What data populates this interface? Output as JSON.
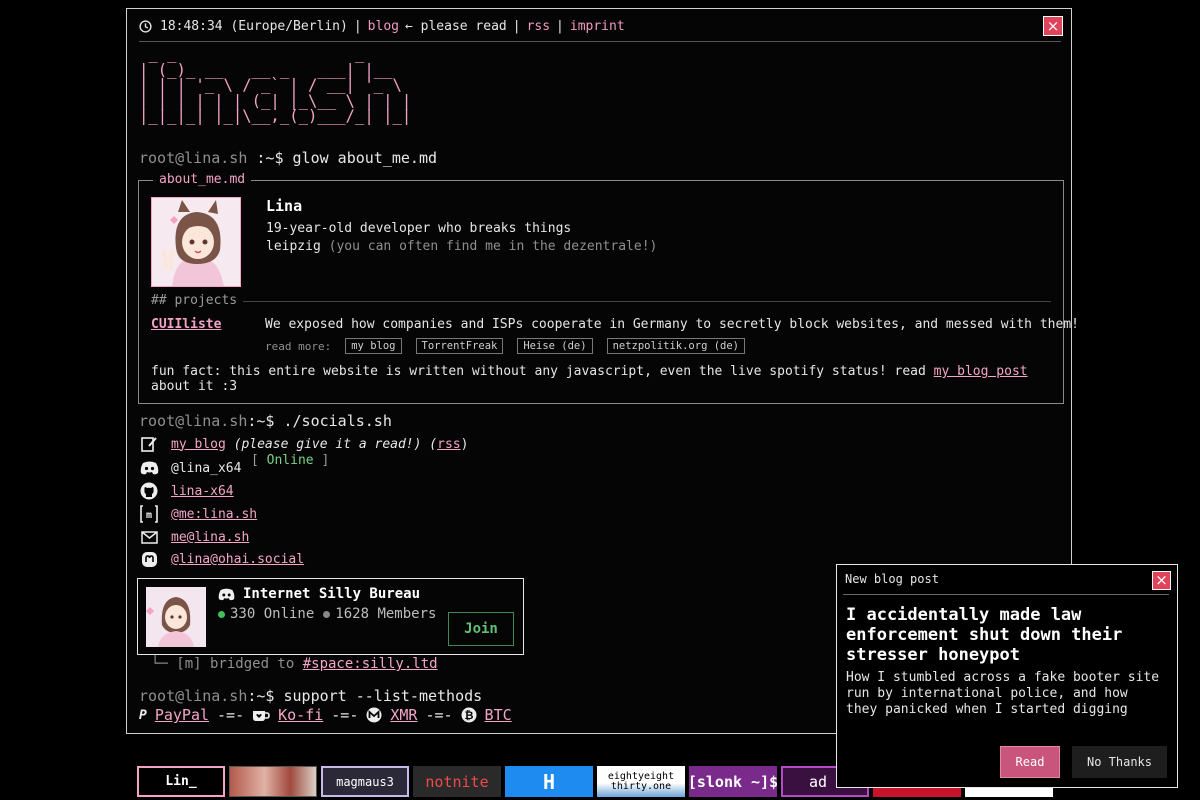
{
  "topbar": {
    "time": "18:48:34 (Europe/Berlin)",
    "blog": "blog",
    "please_read": "← please read",
    "rss": "rss",
    "imprint": "imprint",
    "sep": "|"
  },
  "close_symbol": "×",
  "ascii_logo": " _ _                   _\n| (_)_ __   __ _   ___| |__\n| | | '_ \\ / _` | / __| '_ \\\n| | | | | | (_| |_\\__ \\ | | |\n|_|_|_| |_|\\__,_(_)___/_| |_|",
  "prompt1": {
    "host": "root@lina.sh",
    "path": " :~$ ",
    "cmd": "glow about_me.md"
  },
  "about": {
    "card_title": "about_me.md",
    "name": "Lina",
    "bio_line1": "19-year-old developer who breaks things",
    "bio_city": "leipzig",
    "bio_note": " (you can often find me in the dezentrale!)",
    "projects_heading": "## projects",
    "project_name": "CUIIliste",
    "project_desc": "We exposed how companies and ISPs cooperate in Germany to secretly block websites, and messed with them!",
    "read_more_label": "read more:",
    "read_more_links": [
      "my blog",
      "TorrentFreak",
      "Heise (de)",
      "netzpolitik.org (de)"
    ],
    "fun_fact": "fun fact: this entire website is written without any javascript, even the live spotify status! read ",
    "fun_fact_link": "my blog post",
    "fun_fact_end": "about it :3"
  },
  "prompt2": {
    "host": "root@lina.sh",
    "path": ":~$ ",
    "cmd": "./socials.sh"
  },
  "socials": {
    "blog_link": "my blog",
    "blog_note": " (please give it a read!) (",
    "rss_link": "rss",
    "rss_close": ")",
    "discord_user": "@lina_x64",
    "online_status": "Online",
    "online_open": "[ ",
    "online_close": " ]",
    "github": "lina-x64",
    "matrix": "@me:lina.sh",
    "email": "me@lina.sh",
    "mastodon": "@lina@ohai.social"
  },
  "discord_widget": {
    "server": "Internet Silly Bureau",
    "online": "330 Online",
    "members": "1628 Members",
    "join": "Join"
  },
  "bridged": {
    "prefix": "└─ [m] bridged to ",
    "link": "#space:silly.ltd"
  },
  "prompt3": {
    "host": "root@lina.sh",
    "path": ":~$ ",
    "cmd": "support --list-methods"
  },
  "support": {
    "sep": "-=-",
    "methods": [
      "PayPal",
      "Ko-fi",
      "XMR",
      "BTC"
    ]
  },
  "popup": {
    "title": "New blog post",
    "headline": "I accidentally made law enforcement shut down their stresser honeypot",
    "body": "How I stumbled across a fake booter site run by international police, and how they panicked when I started digging",
    "read": "Read",
    "no_thanks": "No Thanks"
  },
  "badges": [
    "Lin_",
    "",
    "magmaus3",
    "notnite",
    "H",
    "eightyeight thirty.one",
    "[slonk ~]$",
    "ad",
    "",
    ""
  ],
  "colors": {
    "accent_pink": "#f2a3c6",
    "close_red": "#e0445a",
    "online_green": "#7dd08a",
    "read_button": "#c9547c"
  }
}
